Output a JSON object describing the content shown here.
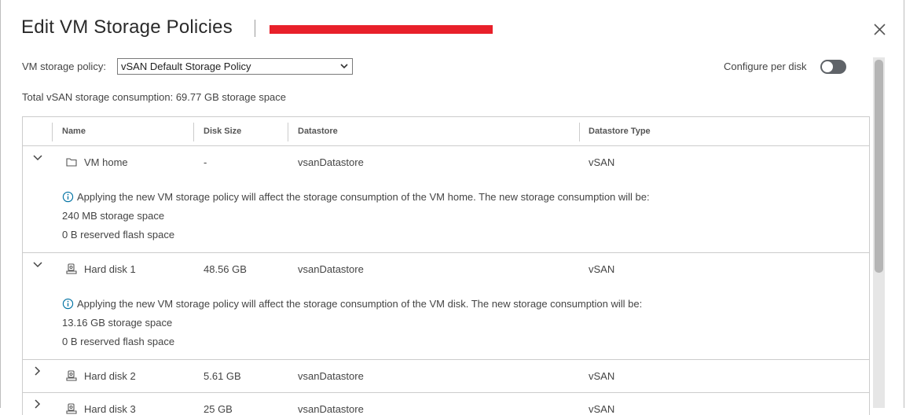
{
  "dialog": {
    "title": "Edit VM Storage Policies",
    "subtitle": "",
    "close_icon": "close-icon"
  },
  "policy": {
    "label": "VM storage policy:",
    "selected": "vSAN Default Storage Policy"
  },
  "per_disk": {
    "label": "Configure per disk",
    "enabled": false
  },
  "total": "Total vSAN storage consumption: 69.77 GB storage space",
  "table": {
    "columns": [
      "Name",
      "Disk Size",
      "Datastore",
      "Datastore Type"
    ],
    "rows": [
      {
        "icon": "folder-icon",
        "name": "VM home",
        "disk_size": "-",
        "datastore": "vsanDatastore",
        "type": "vSAN",
        "expanded": true,
        "info": "Applying the new VM storage policy will affect the storage consumption of the VM home. The new storage consumption will be:",
        "storage": "240 MB storage space",
        "flash": "0 B reserved flash space"
      },
      {
        "icon": "hard-disk-icon",
        "name": "Hard disk 1",
        "disk_size": "48.56 GB",
        "datastore": "vsanDatastore",
        "type": "vSAN",
        "expanded": true,
        "info": "Applying the new VM storage policy will affect the storage consumption of the VM disk. The new storage consumption will be:",
        "storage": "13.16 GB storage space",
        "flash": "0 B reserved flash space"
      },
      {
        "icon": "hard-disk-icon",
        "name": "Hard disk 2",
        "disk_size": "5.61 GB",
        "datastore": "vsanDatastore",
        "type": "vSAN",
        "expanded": false
      },
      {
        "icon": "hard-disk-icon",
        "name": "Hard disk 3",
        "disk_size": "25 GB",
        "datastore": "vsanDatastore",
        "type": "vSAN",
        "expanded": false
      }
    ]
  },
  "colors": {
    "info_blue": "#0072a3",
    "redaction": "#e8202a",
    "toggle_off": "#5f6368"
  }
}
